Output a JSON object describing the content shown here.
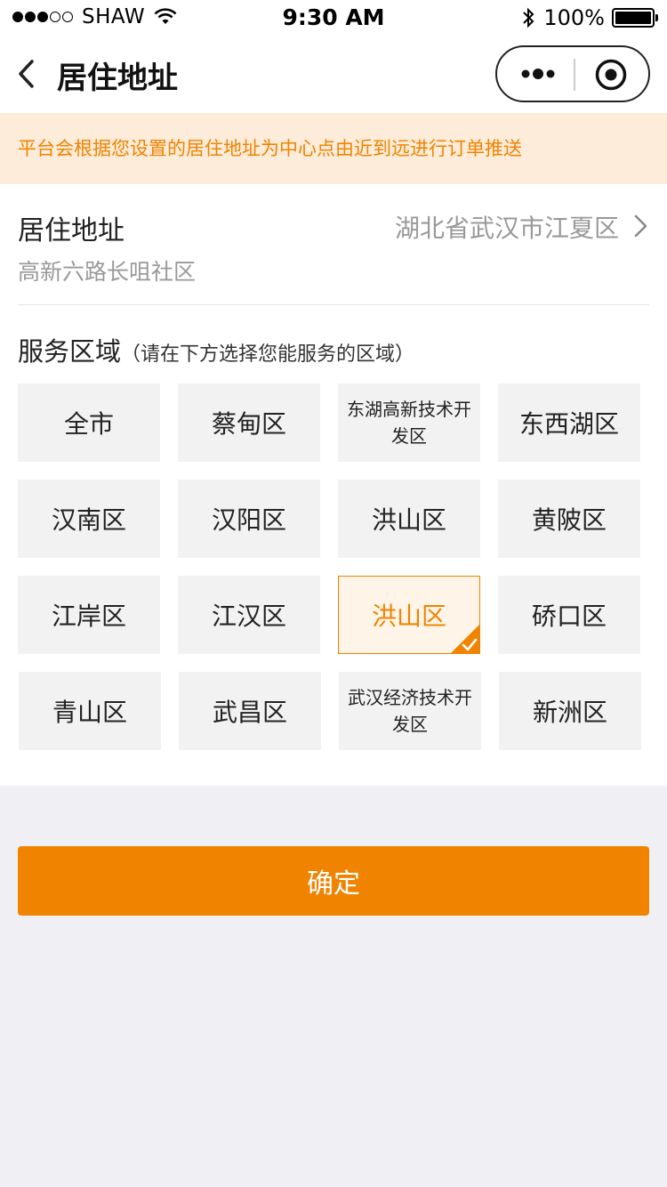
{
  "status_bar": {
    "carrier": "SHAW",
    "time": "9:30 AM",
    "battery": "100%"
  },
  "nav": {
    "title": "居住地址"
  },
  "notice": {
    "text": "平台会根据您设置的居住地址为中心点由近到远进行订单推送",
    "color": "#f08300",
    "background": "#fdecd9"
  },
  "address": {
    "label": "居住地址",
    "value": "湖北省武汉市江夏区",
    "detail": "高新六路长咀社区"
  },
  "service": {
    "title": "服务区域",
    "hint": "（请在下方选择您能服务的区域）",
    "areas": [
      {
        "label": "全市",
        "selected": false
      },
      {
        "label": "蔡甸区",
        "selected": false
      },
      {
        "label": "东湖高新技术开发区",
        "selected": false
      },
      {
        "label": "东西湖区",
        "selected": false
      },
      {
        "label": "汉南区",
        "selected": false
      },
      {
        "label": "汉阳区",
        "selected": false
      },
      {
        "label": "洪山区",
        "selected": false
      },
      {
        "label": "黄陂区",
        "selected": false
      },
      {
        "label": "江岸区",
        "selected": false
      },
      {
        "label": "江汉区",
        "selected": false
      },
      {
        "label": "洪山区",
        "selected": true
      },
      {
        "label": "硚口区",
        "selected": false
      },
      {
        "label": "青山区",
        "selected": false
      },
      {
        "label": "武昌区",
        "selected": false
      },
      {
        "label": "武汉经济技术开发区",
        "selected": false
      },
      {
        "label": "新洲区",
        "selected": false
      }
    ]
  },
  "confirm": {
    "label": "确定",
    "color": "#f08300"
  }
}
